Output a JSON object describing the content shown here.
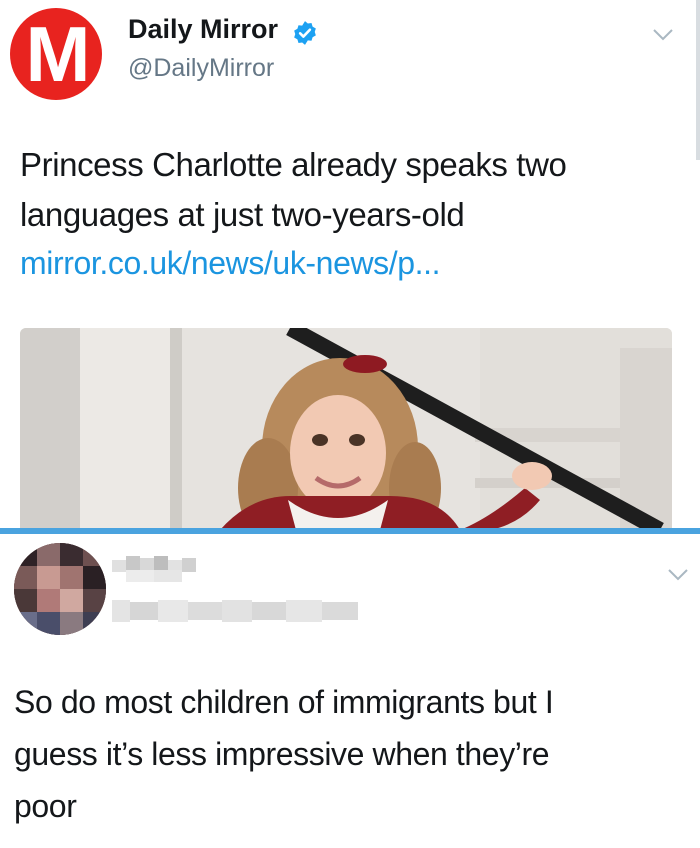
{
  "tweet1": {
    "author_name": "Daily Mirror",
    "author_handle": "@DailyMirror",
    "logo_letter": "M",
    "text_line1": "Princess Charlotte already speaks two",
    "text_line2": "languages at just two-years-old",
    "link": "mirror.co.uk/news/uk-news/p...",
    "verified": true
  },
  "tweet2": {
    "author_name": "",
    "author_handle": "",
    "text_line1": "So do most children of immigrants but I",
    "text_line2": "guess it’s less impressive when they’re",
    "text_line3": "poor"
  },
  "colors": {
    "link": "#1b95e0",
    "verified": "#1da1f2",
    "mirror_red": "#e8231f",
    "divider": "#4aa3df"
  },
  "icons": [
    "verified-badge-icon",
    "chevron-down-icon"
  ]
}
